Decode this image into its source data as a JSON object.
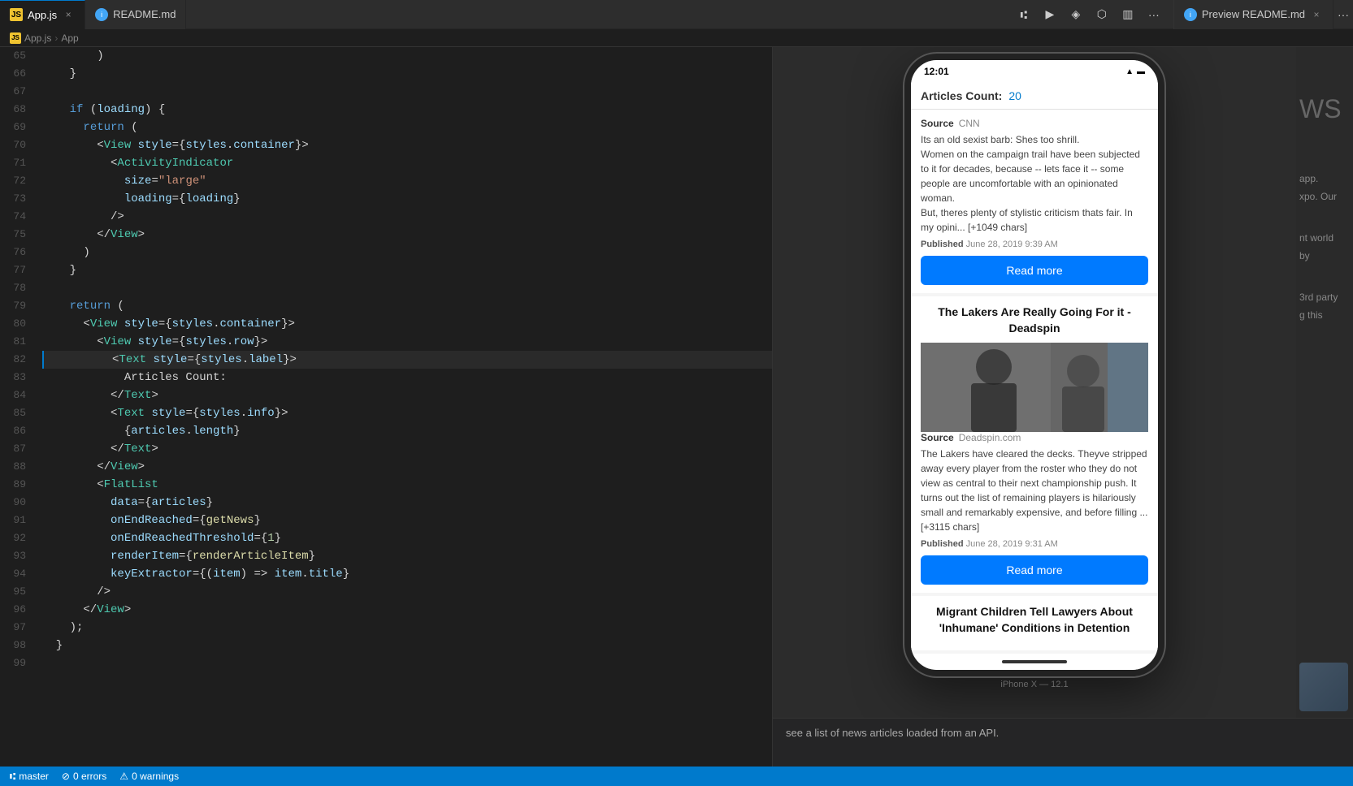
{
  "tabs": [
    {
      "id": "appjs",
      "label": "App.js",
      "icon": "js",
      "active": true,
      "closable": true
    },
    {
      "id": "readme",
      "label": "README.md",
      "icon": "md",
      "active": false,
      "closable": false
    },
    {
      "id": "preview",
      "label": "Preview README.md",
      "icon": "md",
      "active": false,
      "closable": true
    }
  ],
  "breadcrumb": {
    "items": [
      "App.js",
      "App"
    ]
  },
  "toolbar": {
    "more_label": "···"
  },
  "code": {
    "lines": [
      {
        "num": 65,
        "content": "        )"
      },
      {
        "num": 66,
        "content": "    }"
      },
      {
        "num": 67,
        "content": ""
      },
      {
        "num": 68,
        "content": "    if (loading) {",
        "active": false
      },
      {
        "num": 69,
        "content": "      return ("
      },
      {
        "num": 70,
        "content": "        <View style={styles.container}>"
      },
      {
        "num": 71,
        "content": "          <ActivityIndicator"
      },
      {
        "num": 72,
        "content": "            size=\"large\""
      },
      {
        "num": 73,
        "content": "            loading={loading}"
      },
      {
        "num": 74,
        "content": "          />"
      },
      {
        "num": 75,
        "content": "        </View>"
      },
      {
        "num": 76,
        "content": "      )"
      },
      {
        "num": 77,
        "content": "    }"
      },
      {
        "num": 78,
        "content": ""
      },
      {
        "num": 79,
        "content": "    return ("
      },
      {
        "num": 80,
        "content": "      <View style={styles.container}>"
      },
      {
        "num": 81,
        "content": "        <View style={styles.row}>"
      },
      {
        "num": 82,
        "content": "          <Text style={styles.label}>",
        "active": true
      },
      {
        "num": 83,
        "content": "            Articles Count:"
      },
      {
        "num": 84,
        "content": "          </Text>"
      },
      {
        "num": 85,
        "content": "          <Text style={styles.info}>"
      },
      {
        "num": 86,
        "content": "            {articles.length}"
      },
      {
        "num": 87,
        "content": "          </Text>"
      },
      {
        "num": 88,
        "content": "        </View>"
      },
      {
        "num": 89,
        "content": "        <FlatList"
      },
      {
        "num": 90,
        "content": "          data={articles}"
      },
      {
        "num": 91,
        "content": "          onEndReached={getNews}"
      },
      {
        "num": 92,
        "content": "          onEndReachedThreshold={1}"
      },
      {
        "num": 93,
        "content": "          renderItem={renderArticleItem}"
      },
      {
        "num": 94,
        "content": "          keyExtractor={(item) => item.title}"
      },
      {
        "num": 95,
        "content": "        />"
      },
      {
        "num": 96,
        "content": "      </View>"
      },
      {
        "num": 97,
        "content": "    );"
      },
      {
        "num": 98,
        "content": "  }"
      },
      {
        "num": 99,
        "content": ""
      }
    ]
  },
  "phone": {
    "time": "12:01",
    "device_label": "iPhone X — 12.1",
    "articles_count_label": "Articles Count:",
    "articles_count_value": "20",
    "articles": [
      {
        "id": "article1",
        "source_label": "Source",
        "source": "CNN",
        "text": "Its an old sexist barb: Shes too shrill.\nWomen on the campaign trail have been subjected to it for decades, because -- lets face it -- some people are uncomfortable with an opinionated woman.\nBut, theres plenty of stylistic criticism thats fair. In my opini... [+1049 chars]",
        "published_label": "Published",
        "published": "June 28, 2019 9:39 AM",
        "read_more": "Read more"
      },
      {
        "id": "article2",
        "title": "The Lakers Are Really Going For it - Deadspin",
        "source_label": "Source",
        "source": "Deadspin.com",
        "text": "The Lakers have cleared the decks. Theyve stripped away every player from the roster who they do not view as central to their next championship push. It turns out the list of remaining players is hilariously small and remarkably expensive, and before filling ... [+3115 chars]",
        "published_label": "Published",
        "published": "June 28, 2019 9:31 AM",
        "read_more": "Read more"
      },
      {
        "id": "article3",
        "title": "Migrant Children Tell Lawyers About 'Inhumane' Conditions in Detention"
      }
    ]
  },
  "preview_tab": {
    "label": "Preview README.md",
    "overlay_text": [
      "WS",
      "app.",
      "xpo. Our",
      "nt world",
      "by",
      "3rd party",
      "g this",
      "see a list",
      "of news articles loaded",
      "from an API."
    ]
  },
  "bottom_bar": {
    "branch": "master",
    "errors": "0 errors",
    "warnings": "0 warnings"
  }
}
